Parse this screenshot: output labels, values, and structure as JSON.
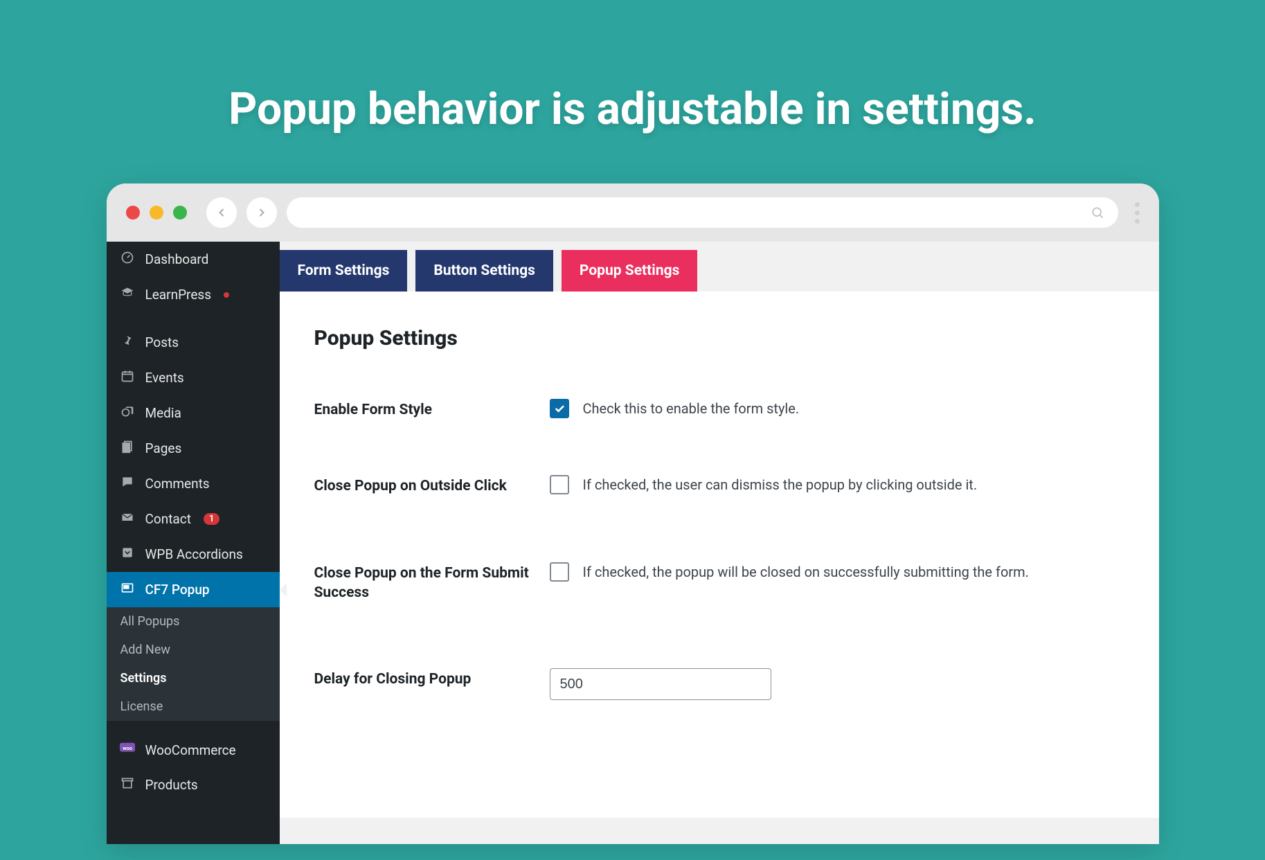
{
  "hero": {
    "title": "Popup behavior is adjustable in settings."
  },
  "sidebar": {
    "items": [
      {
        "label": "Dashboard",
        "icon": "dashboard"
      },
      {
        "label": "LearnPress",
        "icon": "learn",
        "update": true
      },
      {
        "label": "Posts",
        "icon": "pin"
      },
      {
        "label": "Events",
        "icon": "calendar"
      },
      {
        "label": "Media",
        "icon": "media"
      },
      {
        "label": "Pages",
        "icon": "pages"
      },
      {
        "label": "Comments",
        "icon": "comments"
      },
      {
        "label": "Contact",
        "icon": "contact",
        "badge": "1"
      },
      {
        "label": "WPB Accordions",
        "icon": "accordion"
      },
      {
        "label": "CF7 Popup",
        "icon": "popup",
        "active": true
      },
      {
        "label": "WooCommerce",
        "icon": "woo"
      },
      {
        "label": "Products",
        "icon": "products"
      }
    ],
    "submenu": [
      {
        "label": "All Popups"
      },
      {
        "label": "Add New"
      },
      {
        "label": "Settings",
        "current": true
      },
      {
        "label": "License"
      }
    ]
  },
  "tabs": [
    {
      "label": "Form Settings"
    },
    {
      "label": "Button Settings"
    },
    {
      "label": "Popup Settings",
      "active": true
    }
  ],
  "panel": {
    "heading": "Popup Settings",
    "rows": [
      {
        "label": "Enable Form Style",
        "checked": true,
        "desc": "Check this to enable the form style."
      },
      {
        "label": "Close Popup on Outside Click",
        "checked": false,
        "desc": "If checked, the user can dismiss the popup by clicking outside it."
      },
      {
        "label": "Close Popup on the Form Submit Success",
        "checked": false,
        "desc": "If checked, the popup will be closed on successfully submitting the form."
      },
      {
        "label": "Delay for Closing Popup",
        "input": "500"
      }
    ]
  }
}
